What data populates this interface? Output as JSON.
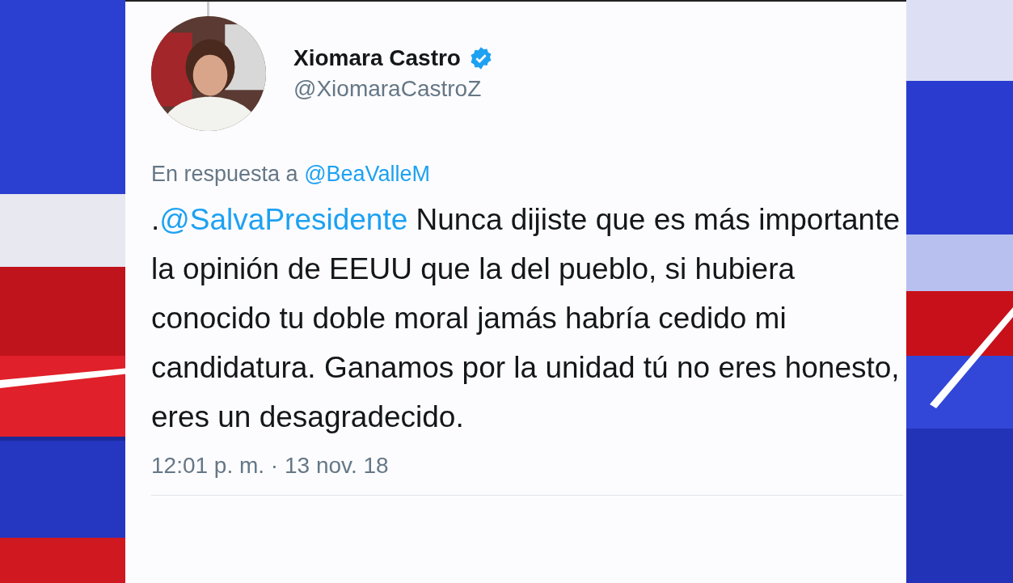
{
  "tweet": {
    "author": {
      "name": "Xiomara Castro",
      "handle": "@XiomaraCastroZ",
      "verified": true
    },
    "reply_to": {
      "prefix": "En respuesta a",
      "mention": "@BeaValleM"
    },
    "body": [
      {
        "kind": "text",
        "text": "."
      },
      {
        "kind": "mention",
        "text": "@SalvaPresidente"
      },
      {
        "kind": "text",
        "text": " Nunca dijiste que es más importante la opinión de EEUU que la del pueblo, si hubiera conocido tu doble moral jamás habría cedido mi candidatura. Ganamos por la unidad tú no eres honesto, eres un desagradecido."
      }
    ],
    "timestamp": "12:01 p. m. · 13 nov. 18"
  }
}
